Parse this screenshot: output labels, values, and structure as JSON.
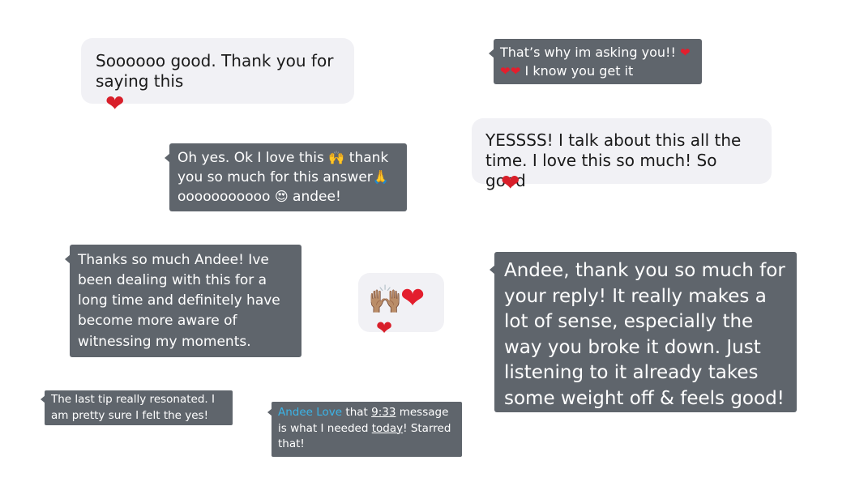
{
  "messages": {
    "m1": {
      "text": "Soooooo good. Thank you for saying this",
      "reaction": "❤"
    },
    "m2": {
      "line1": "That’s why im asking you!! ",
      "line2_hearts": "❤❤",
      "line2_text": " I know you get it",
      "heart_inline": "❤"
    },
    "m3": {
      "text": "YESSSS! I talk about this all the time. I love this so much! So good",
      "reaction": "❤"
    },
    "m4": {
      "part1": "Oh yes. Ok I love this ",
      "emoji1": "🙌",
      "part2": " thank you so much for this answer",
      "emoji2": "🙏",
      "part3": " ooooooooooo ",
      "emoji3": "😍",
      "part4": " andee!"
    },
    "m5": {
      "text": "Thanks so much Andee! Ive been dealing with this for a long time and definitely have become more aware of witnessing my moments."
    },
    "m6": {
      "hands": "🙌🏽",
      "heart": "❤",
      "reaction": "❤"
    },
    "m7": {
      "text": "Andee, thank you so much for your reply! It really makes a lot of sense, especially the way you broke it down. Just listening to it already takes some weight off & feels good!"
    },
    "m8": {
      "text": "The last tip really resonated. I am pretty sure I felt the yes!"
    },
    "m9": {
      "name": "Andee Love",
      "part1": " that ",
      "time": "9:33",
      "part2": " message is what I needed ",
      "today": "today",
      "part3": "! Starred that!"
    }
  },
  "colors": {
    "light_bubble": "#f1f1f5",
    "dark_bubble": "#5f656c",
    "heart": "#d81f2a",
    "mention": "#3bb3e6"
  }
}
